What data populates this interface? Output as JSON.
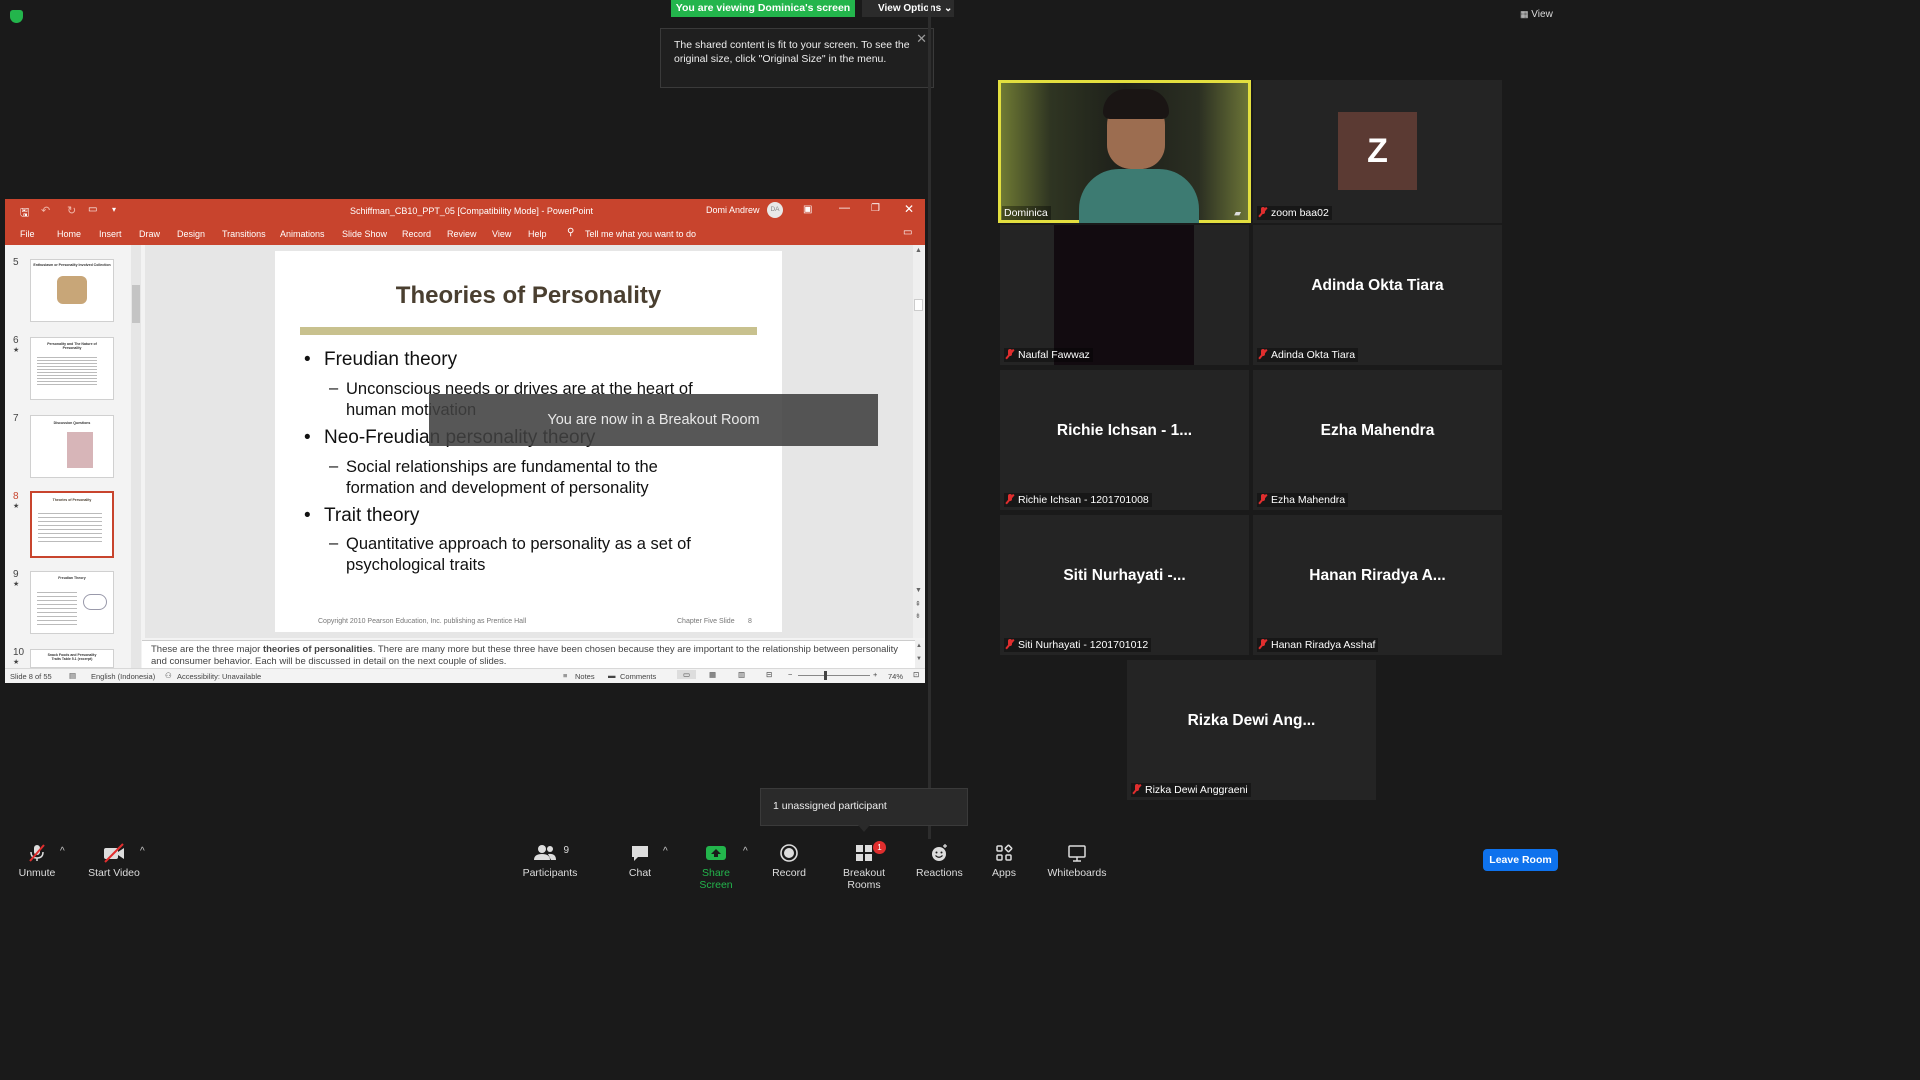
{
  "top": {
    "viewing_banner": "You are viewing Dominica's screen",
    "view_options": "View Options",
    "view_button": "View",
    "tooltip_text": "The shared content is fit to your screen. To see the original size, click \"Original Size\" in the menu."
  },
  "ppt": {
    "window_title": "Schiffman_CB10_PPT_05 [Compatibility Mode]  -  PowerPoint",
    "user_name": "Domi Andrew",
    "user_initials": "DA",
    "ribbon_tabs": [
      "File",
      "Home",
      "Insert",
      "Draw",
      "Design",
      "Transitions",
      "Animations",
      "Slide Show",
      "Record",
      "Review",
      "View",
      "Help"
    ],
    "tell_me": "Tell me what you want to do",
    "thumb_numbers": [
      "5",
      "6",
      "7",
      "8",
      "9",
      "10"
    ],
    "thumb_titles": [
      "Enthusiasm or Personality Involved Collection",
      "Personality and The Nature of Personality",
      "Discussion Questions",
      "Theories of Personality",
      "Freudian Theory",
      "Snack Foods and Personality Traits Table 5.1 (excerpt)"
    ],
    "slide": {
      "title": "Theories of Personality",
      "bullets": [
        "Freudian theory",
        "Unconscious needs or drives are at the heart of human motivation",
        "Neo-Freudian personality theory",
        "Social relationships are fundamental to the formation and development of personality",
        "Trait theory",
        "Quantitative approach to personality as a set of psychological traits"
      ],
      "footer_left": "Copyright 2010 Pearson Education, Inc. publishing as Prentice Hall",
      "footer_right": "Chapter Five Slide",
      "page": "8"
    },
    "notes_prefix": "These are the three major",
    "notes_bold": "theories of personalities",
    "notes_suffix": ".  There are many more but these three have been chosen because they are important to the relationship between personality and consumer behavior.  Each will be discussed in detail on the next couple of slides.",
    "status": {
      "slide_count": "Slide 8 of 55",
      "language": "English (Indonesia)",
      "accessibility": "Accessibility: Unavailable",
      "notes": "Notes",
      "comments": "Comments",
      "zoom": "74%"
    }
  },
  "breakout_message": "You are now in a Breakout Room",
  "participants": [
    {
      "label": "Dominica"
    },
    {
      "label": "zoom baa02",
      "initial": "Z"
    },
    {
      "label": "Naufal Fawwaz"
    },
    {
      "label": "Adinda Okta Tiara",
      "display": "Adinda Okta Tiara"
    },
    {
      "label": "Richie Ichsan - 1201701008",
      "display": "Richie Ichsan - 1..."
    },
    {
      "label": "Ezha Mahendra",
      "display": "Ezha Mahendra"
    },
    {
      "label": "Siti Nurhayati - 1201701012",
      "display": "Siti Nurhayati -..."
    },
    {
      "label": "Hanan Riradya Asshaf",
      "display": "Hanan Riradya A..."
    },
    {
      "label": "Rizka Dewi Anggraeni",
      "display": "Rizka Dewi Ang..."
    }
  ],
  "unassigned": "1 unassigned participant",
  "toolbar": {
    "unmute": "Unmute",
    "start_video": "Start Video",
    "participants": "Participants",
    "participants_count": "9",
    "chat": "Chat",
    "share_screen": "Share Screen",
    "record": "Record",
    "breakout_rooms": "Breakout Rooms",
    "breakout_badge": "1",
    "reactions": "Reactions",
    "apps": "Apps",
    "whiteboards": "Whiteboards",
    "leave_room": "Leave Room"
  },
  "colors": {
    "ppt_accent": "#c8442d",
    "zoom_green": "#23b54c",
    "leave_blue": "#0e72ed",
    "active_speaker": "#e3df3f"
  }
}
